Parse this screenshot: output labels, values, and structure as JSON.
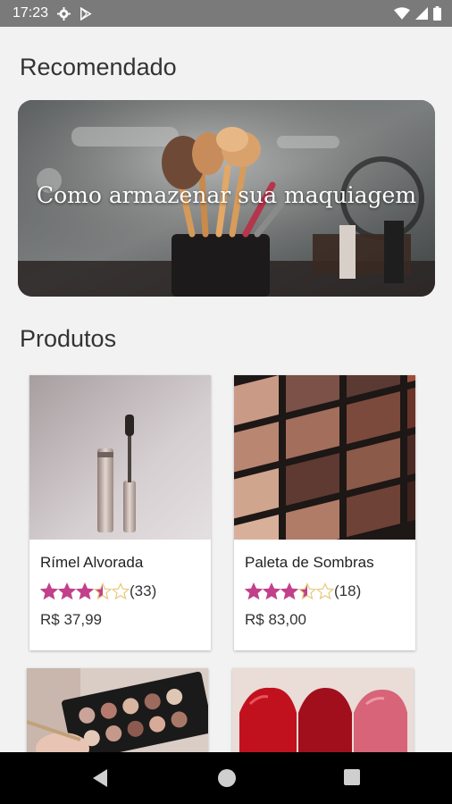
{
  "status_bar": {
    "time": "17:23",
    "left_icons": [
      "gear-icon",
      "play-store-icon"
    ],
    "right_icons": [
      "wifi-icon",
      "cellular-signal-icon",
      "battery-icon"
    ]
  },
  "recommended": {
    "title": "Recomendado",
    "banner_title": "Como armazenar sua maquiagem"
  },
  "products": {
    "title": "Produtos",
    "items": [
      {
        "name": "Rímel Alvorada",
        "rating": 3.5,
        "reviews": "(33)",
        "price": "R$ 37,99"
      },
      {
        "name": "Paleta de Sombras",
        "rating": 3.5,
        "reviews": "(18)",
        "price": "R$ 83,00"
      }
    ]
  },
  "colors": {
    "star_filled": "#c2408b",
    "star_empty": "#e7c87a",
    "status_bar": "#7a7a7a",
    "nav_bar": "#000000"
  },
  "nav_bar": {
    "icons": [
      "back-icon",
      "home-icon",
      "recents-icon"
    ]
  }
}
